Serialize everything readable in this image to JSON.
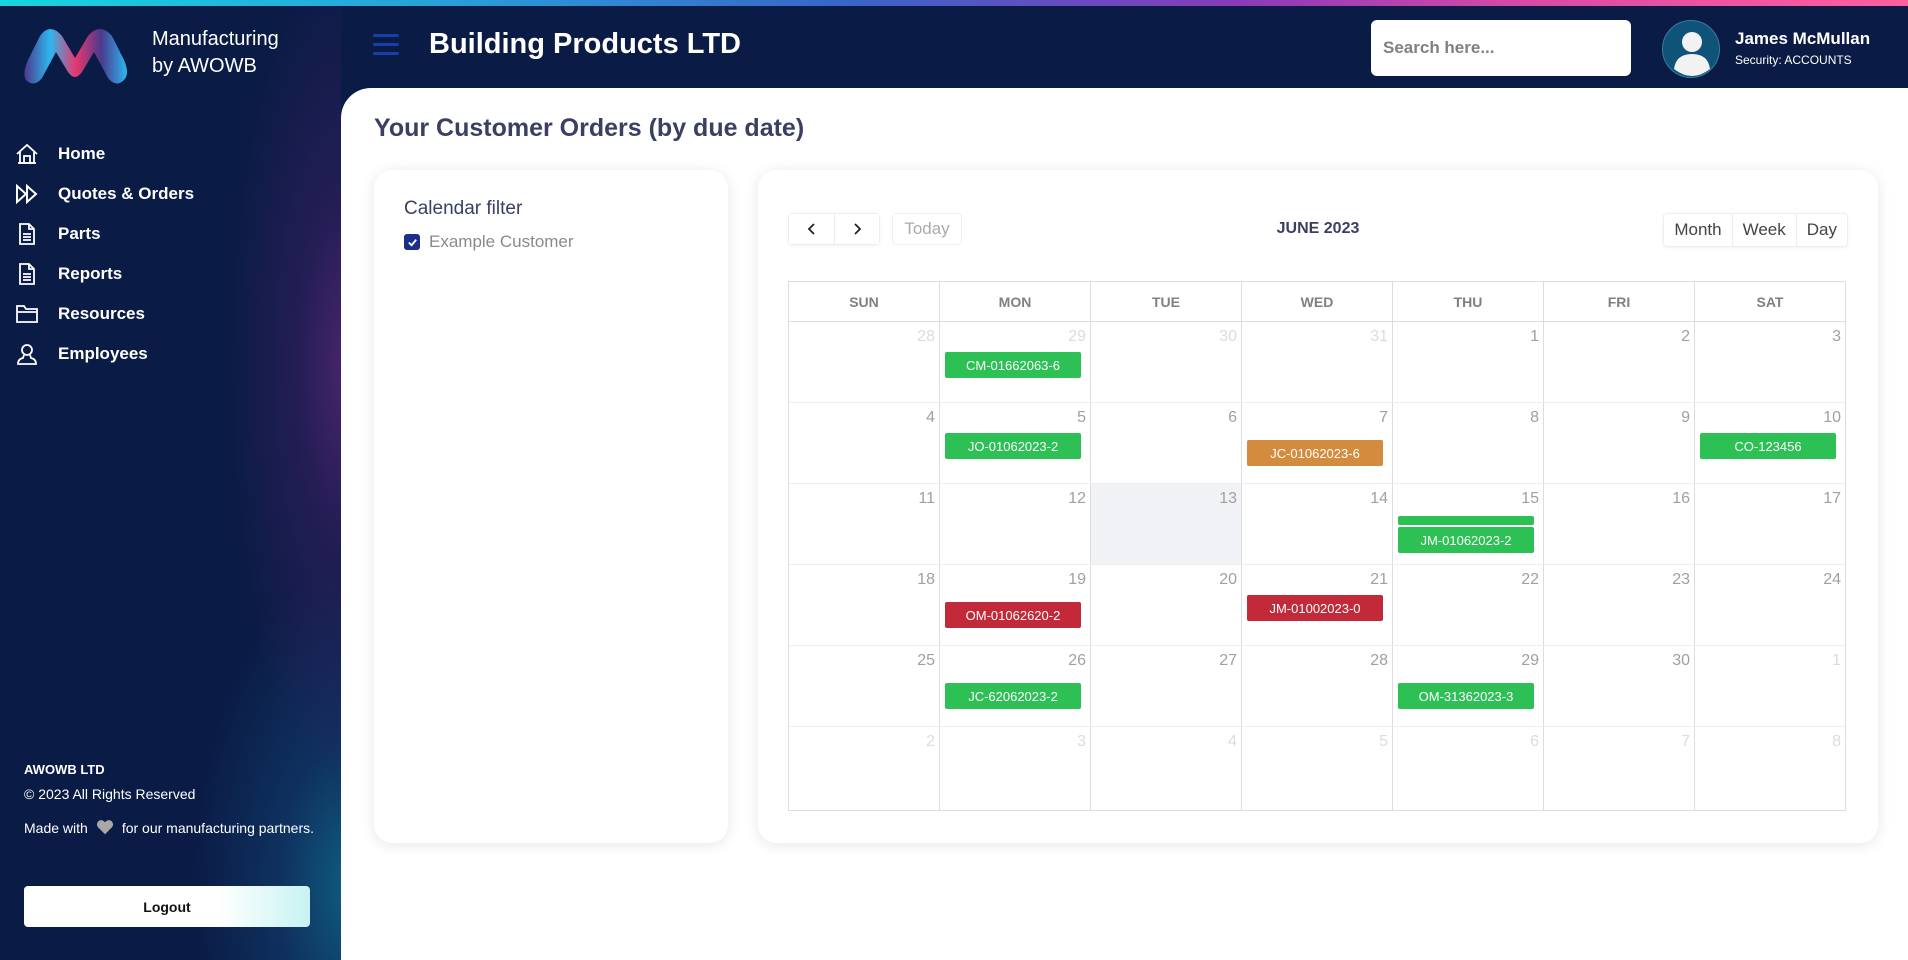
{
  "sidebar": {
    "brand_line1": "Manufacturing",
    "brand_line2": "by AWOWB",
    "items": [
      {
        "label": "Home",
        "icon": "home-icon"
      },
      {
        "label": "Quotes & Orders",
        "icon": "fast-forward-icon"
      },
      {
        "label": "Parts",
        "icon": "document-icon"
      },
      {
        "label": "Reports",
        "icon": "document-icon"
      },
      {
        "label": "Resources",
        "icon": "folder-icon"
      },
      {
        "label": "Employees",
        "icon": "user-icon"
      }
    ],
    "footer": {
      "company": "AWOWB LTD",
      "copyright": "© 2023 All Rights Reserved",
      "made_with_prefix": "Made with",
      "made_with_suffix": "for our manufacturing partners."
    },
    "logout_label": "Logout"
  },
  "header": {
    "title": "Building Products LTD",
    "search_placeholder": "Search here...",
    "user_name": "James McMullan",
    "user_role": "Security: ACCOUNTS"
  },
  "main": {
    "page_title": "Your Customer Orders (by due date)",
    "filter": {
      "title": "Calendar filter",
      "items": [
        {
          "label": "Example Customer",
          "checked": true
        }
      ]
    },
    "calendar": {
      "month_label": "JUNE 2023",
      "today_label": "Today",
      "views": [
        "Month",
        "Week",
        "Day"
      ],
      "active_view": "Month",
      "weekdays": [
        "SUN",
        "MON",
        "TUE",
        "WED",
        "THU",
        "FRI",
        "SAT"
      ],
      "today_date": 13,
      "weeks": [
        [
          {
            "d": 28,
            "o": true
          },
          {
            "d": 29,
            "o": true
          },
          {
            "d": 30,
            "o": true
          },
          {
            "d": 31,
            "o": true
          },
          {
            "d": 1
          },
          {
            "d": 2
          },
          {
            "d": 3
          }
        ],
        [
          {
            "d": 4
          },
          {
            "d": 5
          },
          {
            "d": 6
          },
          {
            "d": 7
          },
          {
            "d": 8
          },
          {
            "d": 9
          },
          {
            "d": 10
          }
        ],
        [
          {
            "d": 11
          },
          {
            "d": 12
          },
          {
            "d": 13
          },
          {
            "d": 14
          },
          {
            "d": 15
          },
          {
            "d": 16
          },
          {
            "d": 17
          }
        ],
        [
          {
            "d": 18
          },
          {
            "d": 19
          },
          {
            "d": 20
          },
          {
            "d": 21
          },
          {
            "d": 22
          },
          {
            "d": 23
          },
          {
            "d": 24
          }
        ],
        [
          {
            "d": 25
          },
          {
            "d": 26
          },
          {
            "d": 27
          },
          {
            "d": 28
          },
          {
            "d": 29
          },
          {
            "d": 30
          },
          {
            "d": 1,
            "o": true
          }
        ],
        [
          {
            "d": 2,
            "o": true
          },
          {
            "d": 3,
            "o": true
          },
          {
            "d": 4,
            "o": true
          },
          {
            "d": 5,
            "o": true
          },
          {
            "d": 6,
            "o": true
          },
          {
            "d": 7,
            "o": true
          },
          {
            "d": 8,
            "o": true
          }
        ]
      ],
      "status_colors": {
        "green": "#2cc055",
        "orange": "#d38c3d",
        "red": "#c22a3a"
      },
      "events": [
        {
          "week": 0,
          "day": 1,
          "label": "CM-01662063-6",
          "status": "green",
          "slot": 0
        },
        {
          "week": 1,
          "day": 1,
          "label": "JO-01062023-2",
          "status": "green",
          "slot": 0
        },
        {
          "week": 1,
          "day": 3,
          "label": "JC-01062023-6",
          "status": "orange",
          "slot": 1
        },
        {
          "week": 1,
          "day": 6,
          "label": "CO-123456",
          "status": "green",
          "slot": 0
        },
        {
          "week": 2,
          "day": 4,
          "label": "",
          "status": "green",
          "slot": 2
        },
        {
          "week": 2,
          "day": 4,
          "label": "JM-01062023-2",
          "status": "green",
          "slot": 3
        },
        {
          "week": 3,
          "day": 1,
          "label": "OM-01062620-2",
          "status": "red",
          "slot": 1
        },
        {
          "week": 3,
          "day": 3,
          "label": "JM-01002023-0",
          "status": "red",
          "slot": 0
        },
        {
          "week": 4,
          "day": 1,
          "label": "JC-62062023-2",
          "status": "green",
          "slot": 1
        },
        {
          "week": 4,
          "day": 4,
          "label": "OM-31362023-3",
          "status": "green",
          "slot": 1
        }
      ]
    }
  }
}
